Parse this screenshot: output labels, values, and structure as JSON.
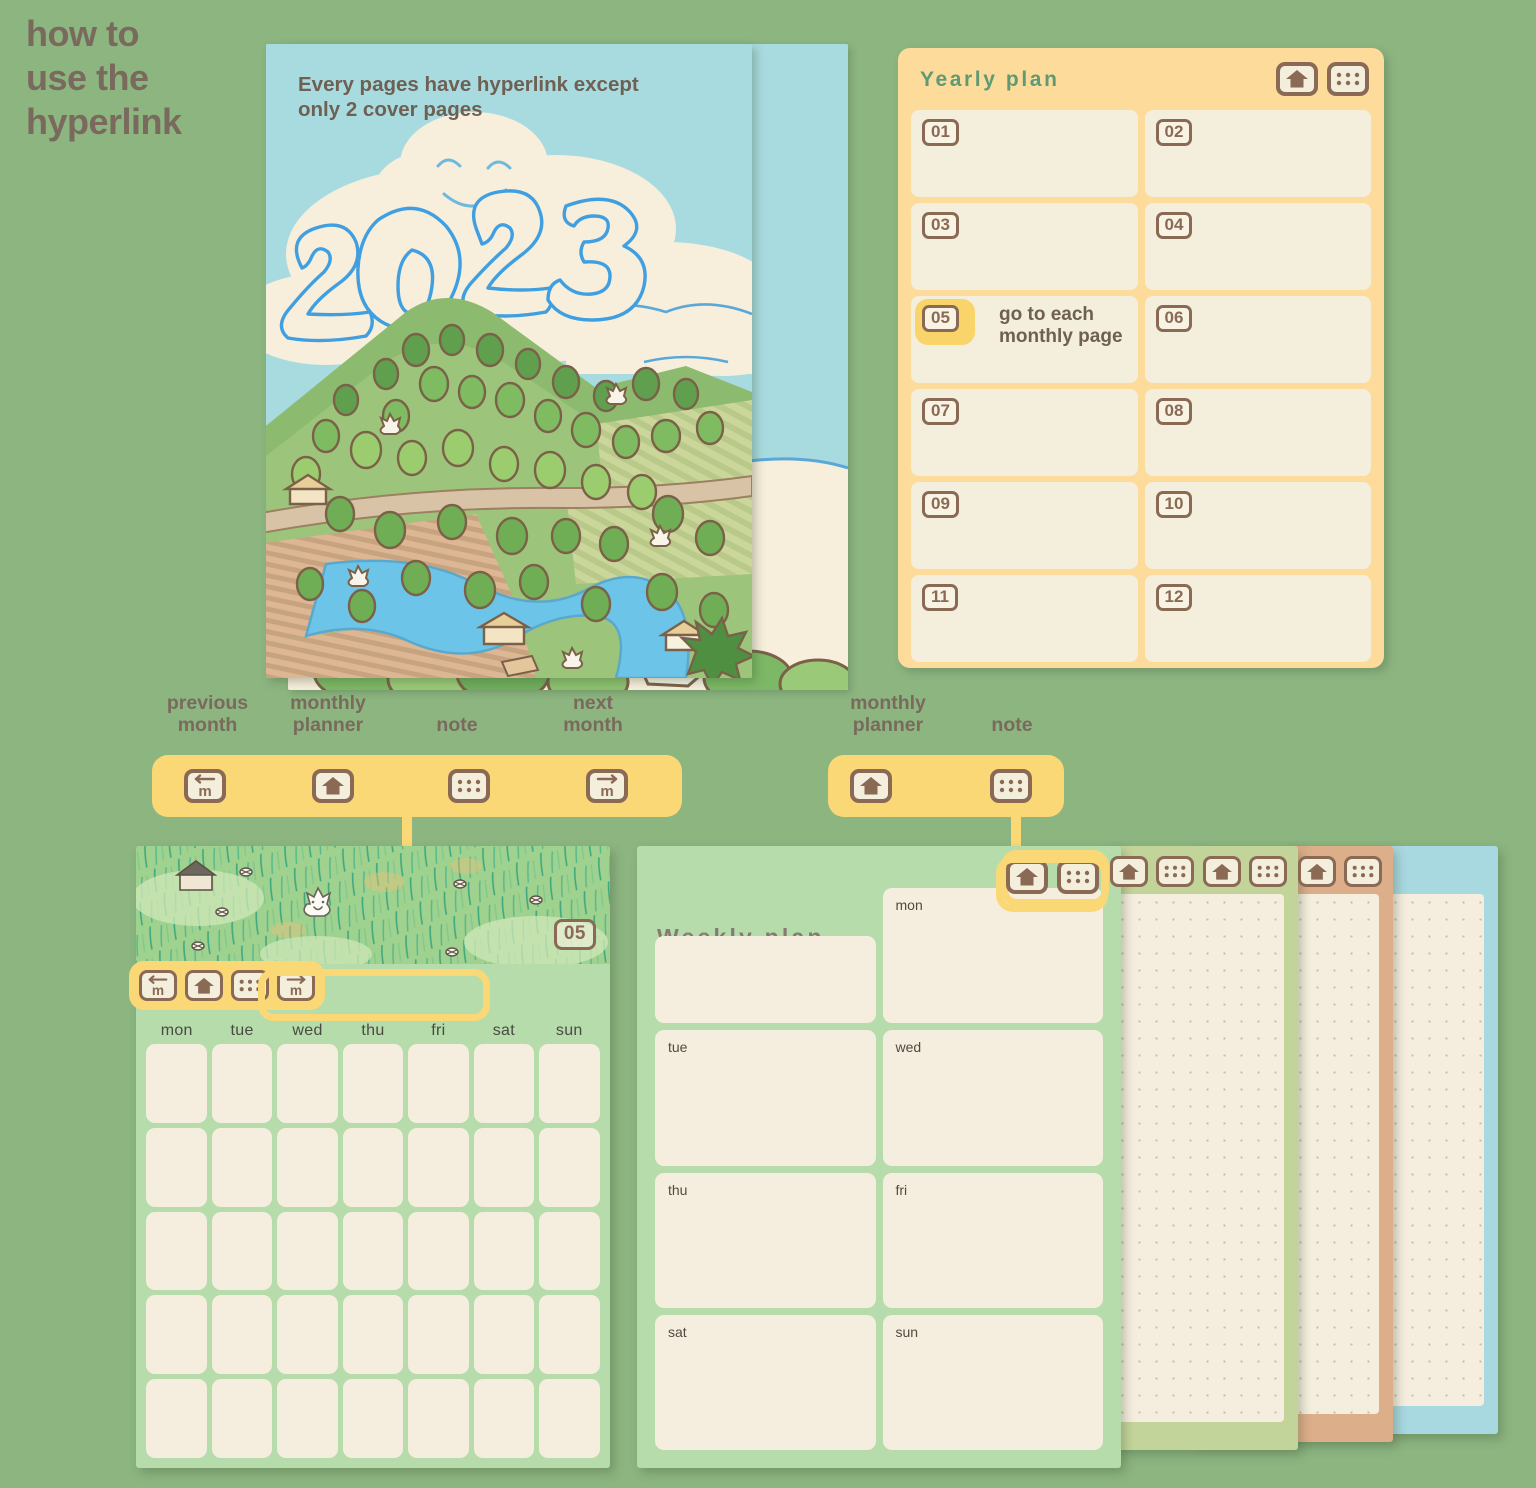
{
  "page": {
    "title": "how to\nuse the\nhyperlink",
    "background_color": "#8cb580",
    "accent_yellow": "#fbd876",
    "brown": "#8a6a55",
    "cream": "#f4eedc",
    "green_page": "#b6dcab"
  },
  "cover": {
    "caption": "Every pages  have hyperlink except\nonly 2 cover pages",
    "year": "2023",
    "sky_color": "#a8dbdf"
  },
  "yearly": {
    "title": "Yearly plan",
    "icons": [
      {
        "name": "home-icon",
        "label": "monthly planner"
      },
      {
        "name": "dots-icon",
        "label": "note"
      }
    ],
    "months": [
      "01",
      "02",
      "03",
      "04",
      "05",
      "06",
      "07",
      "08",
      "09",
      "10",
      "11",
      "12"
    ],
    "highlighted_month": "05",
    "annotation": "go to each\nmonthly page"
  },
  "legend_left": {
    "labels": [
      "previous\nmonth",
      "monthly\nplanner",
      "note",
      "next\nmonth"
    ],
    "icons": [
      "prev-month-icon",
      "home-icon",
      "dots-icon",
      "next-month-icon"
    ]
  },
  "legend_right": {
    "labels": [
      "monthly\nplanner",
      "note"
    ],
    "icons": [
      "home-icon",
      "dots-icon"
    ]
  },
  "monthly": {
    "month_badge": "05",
    "toolbar_icons": [
      "prev-month-icon",
      "home-icon",
      "dots-icon",
      "next-month-icon"
    ],
    "weekdays": [
      "mon",
      "tue",
      "wed",
      "thu",
      "fri",
      "sat",
      "sun"
    ],
    "rows": 5
  },
  "weekly": {
    "title": "Weekly plan",
    "icons": [
      "home-icon",
      "dots-icon"
    ],
    "cells": [
      "",
      "mon",
      "tue",
      "wed",
      "thu",
      "fri",
      "sat",
      "sun"
    ]
  },
  "notes": [
    {
      "accent": "#c3d49a",
      "icons": [
        "home-icon",
        "dots-icon"
      ]
    },
    {
      "accent": "#ddae8a",
      "icons": [
        "home-icon",
        "dots-icon"
      ]
    },
    {
      "accent": "#a8d8e0",
      "icons": [
        "home-icon",
        "dots-icon"
      ]
    }
  ]
}
